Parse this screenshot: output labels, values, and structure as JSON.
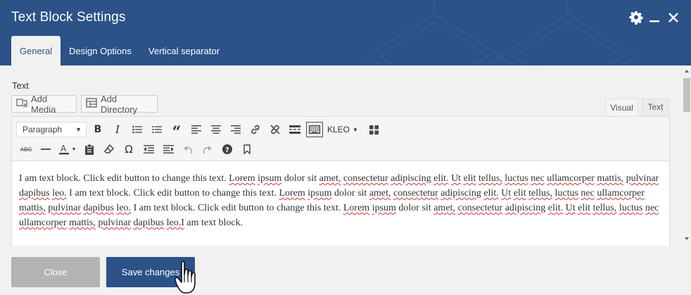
{
  "window": {
    "title": "Text Block Settings"
  },
  "tabs": [
    {
      "label": "General",
      "active": true
    },
    {
      "label": "Design Options",
      "active": false
    },
    {
      "label": "Vertical separator",
      "active": false
    }
  ],
  "field": {
    "label": "Text"
  },
  "media_buttons": {
    "add_media": "Add Media",
    "add_directory": "Add Directory"
  },
  "editor_modes": {
    "visual": "Visual",
    "text": "Text"
  },
  "toolbar": {
    "format_value": "Paragraph",
    "kleo_label": "KLEO",
    "row1_icons": [
      "bold-icon",
      "italic-icon",
      "bullet-list-icon",
      "numbered-list-icon",
      "blockquote-icon",
      "align-left-icon",
      "align-center-icon",
      "align-right-icon",
      "link-icon",
      "unlink-icon",
      "read-more-icon",
      "toolbar-toggle-icon"
    ],
    "row2_icons": [
      "strikethrough-icon",
      "horizontal-line-icon",
      "text-color-icon",
      "paste-as-text-icon",
      "clear-formatting-icon",
      "special-character-icon",
      "outdent-icon",
      "indent-icon",
      "undo-icon",
      "redo-icon",
      "help-icon",
      "bookmark-icon"
    ]
  },
  "editor": {
    "content": "I am text block. Click edit button to change this text. Lorem ipsum dolor sit amet, consectetur adipiscing elit. Ut elit tellus, luctus nec ullamcorper mattis, pulvinar dapibus leo. I am text block. Click edit button to change this text. Lorem ipsum dolor sit amet, consectetur adipiscing elit. Ut elit tellus, luctus nec ullamcorper mattis, pulvinar dapibus leo. I am text block. Click edit button to change this text. Lorem ipsum dolor sit amet, consectetur adipiscing elit. Ut elit tellus, luctus nec ullamcorper mattis, pulvinar dapibus leo.I am text block."
  },
  "footer": {
    "close_label": "Close",
    "save_label": "Save changes"
  },
  "colors": {
    "header_bg": "#2c5288",
    "close_button_bg": "#b3b3b3",
    "save_button_bg": "#2c5288",
    "body_bg": "#f1f1f1"
  }
}
